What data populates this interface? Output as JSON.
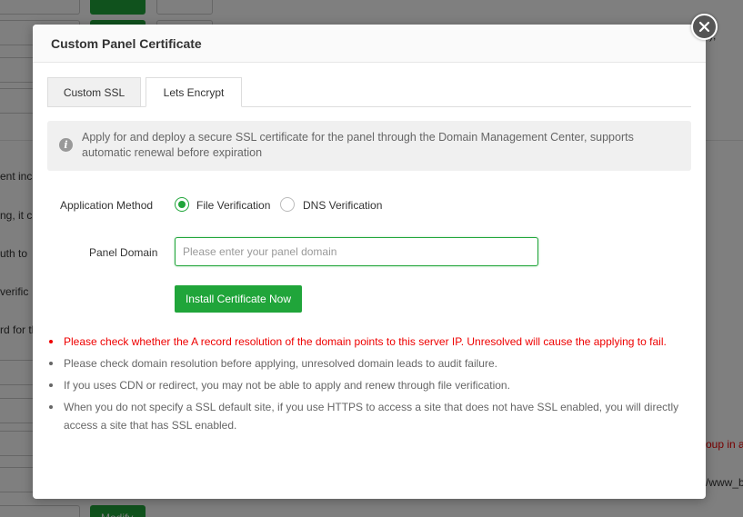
{
  "background": {
    "right_text_1": "),",
    "right_text_2": "oup in a",
    "right_text_3": "/www_b",
    "left_text_1": "ent inc",
    "left_text_2": "ng, it c",
    "left_text_3": "uth to",
    "left_text_4": "verific",
    "left_text_5": "rd for th",
    "bottom_button_label": "Modify"
  },
  "dialog": {
    "title": "Custom Panel Certificate",
    "tabs": [
      {
        "label": "Custom SSL",
        "active": false
      },
      {
        "label": "Lets Encrypt",
        "active": true
      }
    ],
    "info_text": "Apply for and deploy a secure SSL certificate for the panel through the Domain Management Center, supports automatic renewal before expiration",
    "form": {
      "method_label": "Application Method",
      "method_options": [
        {
          "label": "File Verification",
          "checked": true
        },
        {
          "label": "DNS Verification",
          "checked": false
        }
      ],
      "domain_label": "Panel Domain",
      "domain_placeholder": "Please enter your panel domain",
      "domain_value": "",
      "install_button_label": "Install Certificate Now"
    },
    "notes": [
      {
        "text": "Please check whether the A record resolution of the domain points to this server IP. Unresolved will cause the applying to fail.",
        "warning": true
      },
      {
        "text": "Please check domain resolution before applying, unresolved domain leads to audit failure.",
        "warning": false
      },
      {
        "text": "If you uses CDN or redirect, you may not be able to apply and renew through file verification.",
        "warning": false
      },
      {
        "text": "When you do not specify a SSL default site, if you use HTTPS to access a site that does not have SSL enabled, you will directly access a site that has SSL enabled.",
        "warning": false
      }
    ]
  },
  "colors": {
    "accent": "#20a53a",
    "warning": "#ee0000",
    "overlay": "#7f7f7f"
  },
  "icons": {
    "close": "close-icon",
    "info": "info-icon"
  }
}
